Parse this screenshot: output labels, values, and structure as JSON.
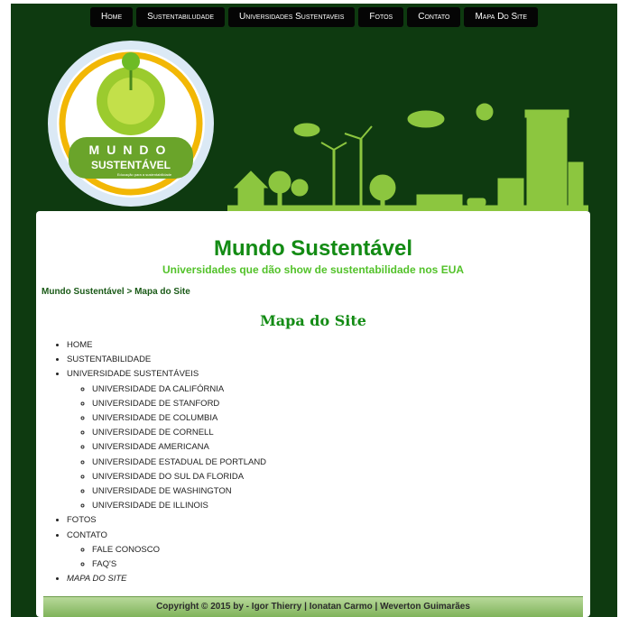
{
  "nav": {
    "items": [
      {
        "label": "Home"
      },
      {
        "label": "Sustentabiludade"
      },
      {
        "label": "Universidades Sustentaveis"
      },
      {
        "label": "Fotos"
      },
      {
        "label": "Contato"
      },
      {
        "label": "Mapa Do Site"
      }
    ]
  },
  "logo": {
    "line1": "MUNDO",
    "line2": "SUSTENTÁVEL",
    "tagline": "Educação para a sustentabilidade"
  },
  "header": {
    "title": "Mundo Sustentável",
    "subtitle": "Universidades que dão show de sustentabilidade nos EUA"
  },
  "breadcrumb": {
    "home": "Mundo Sustentável",
    "separator": " > ",
    "current": "Mapa do Site"
  },
  "page_title": "Mapa do Site",
  "sitemap": {
    "home": "HOME",
    "sustentabilidade": "SUSTENTABILIDADE",
    "universidades": "UNIVERSIDADE SUSTENTÁVEIS",
    "universidades_children": [
      "UNIVERSIDADE DA CALIFÓRNIA",
      "UNIVERSIDADE DE STANFORD",
      "UNIVERSIDADE DE COLUMBIA",
      "UNIVERSIDADE DE CORNELL",
      "UNIVERSIDADE AMERICANA",
      "UNIVERSIDADE ESTADUAL DE PORTLAND",
      "UNIVERSIDADE DO SUL DA FLORIDA",
      "UNIVERSIDADE DE WASHINGTON",
      "UNIVERSIDADE DE ILLINOIS"
    ],
    "fotos": "FOTOS",
    "contato": "CONTATO",
    "contato_children": [
      "FALE CONOSCO",
      "FAQ'S"
    ],
    "mapa": "MAPA DO SITE"
  },
  "footer": {
    "text": "Copyright © 2015 by - Igor Thierry | Ionatan Carmo | Weverton Guimarães"
  },
  "colors": {
    "background": "#0e3a10",
    "title_green": "#138b14",
    "subtitle_green": "#53c22a",
    "nav_bg": "#050505"
  }
}
